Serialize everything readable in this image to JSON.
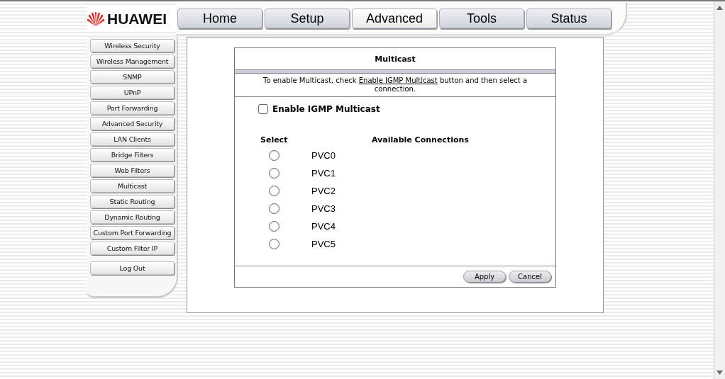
{
  "logo": {
    "text": "HUAWEI"
  },
  "tabs": [
    {
      "label": "Home",
      "selected": false
    },
    {
      "label": "Setup",
      "selected": false
    },
    {
      "label": "Advanced",
      "selected": true
    },
    {
      "label": "Tools",
      "selected": false
    },
    {
      "label": "Status",
      "selected": false
    }
  ],
  "sidebar": {
    "items": [
      {
        "label": "Wireless Security"
      },
      {
        "label": "Wireless Management"
      },
      {
        "label": "SNMP"
      },
      {
        "label": "UPnP"
      },
      {
        "label": "Port Forwarding"
      },
      {
        "label": "Advanced Security"
      },
      {
        "label": "LAN Clients"
      },
      {
        "label": "Bridge Filters"
      },
      {
        "label": "Web Filters"
      },
      {
        "label": "Multicast"
      },
      {
        "label": "Static Routing"
      },
      {
        "label": "Dynamic Routing"
      },
      {
        "label": "Custom Port Forwarding"
      },
      {
        "label": "Custom Filter IP"
      }
    ],
    "logout": "Log Out"
  },
  "panel": {
    "title": "Multicast",
    "instruction": {
      "before": "To enable Multicast, check ",
      "link": "Enable IGMP Multicast",
      "after": " button and then select a connection."
    },
    "enable": {
      "label": "Enable IGMP Multicast",
      "checked": false
    },
    "columns": [
      "Select",
      "Available Connections"
    ],
    "connections": [
      {
        "name": "PVC0",
        "selected": false
      },
      {
        "name": "PVC1",
        "selected": false
      },
      {
        "name": "PVC2",
        "selected": false
      },
      {
        "name": "PVC3",
        "selected": false
      },
      {
        "name": "PVC4",
        "selected": false
      },
      {
        "name": "PVC5",
        "selected": false
      }
    ],
    "buttons": [
      "Apply",
      "Cancel"
    ]
  }
}
